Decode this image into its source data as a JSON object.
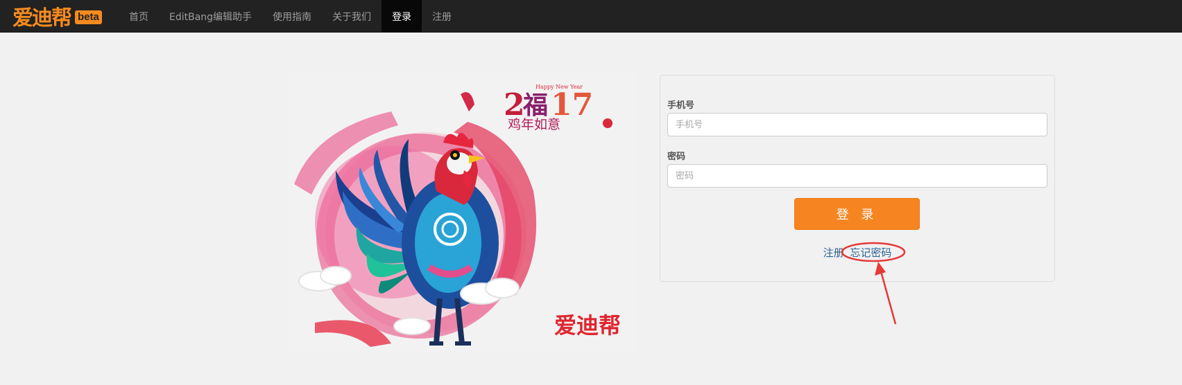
{
  "navbar": {
    "brand": "爱迪帮",
    "badge": "beta",
    "items": [
      {
        "label": "首页",
        "active": false
      },
      {
        "label": "EditBang编辑助手",
        "active": false
      },
      {
        "label": "使用指南",
        "active": false
      },
      {
        "label": "关于我们",
        "active": false
      },
      {
        "label": "登录",
        "active": true
      },
      {
        "label": "注册",
        "active": false
      }
    ]
  },
  "hero": {
    "top_small": "Happy New Year",
    "year_a": "2",
    "year_fu": "福",
    "year_b": "17",
    "slogan": "鸡年如意",
    "watermark": "爱迪帮"
  },
  "login": {
    "phone_label": "手机号",
    "phone_placeholder": "手机号",
    "password_label": "密码",
    "password_placeholder": "密码",
    "submit": "登 录",
    "register_link": "注册",
    "forgot_link": "忘记密码"
  },
  "colors": {
    "accent": "#f68521",
    "navbar_bg": "#222222",
    "link": "#2a6496",
    "annotation": "#e53935"
  }
}
